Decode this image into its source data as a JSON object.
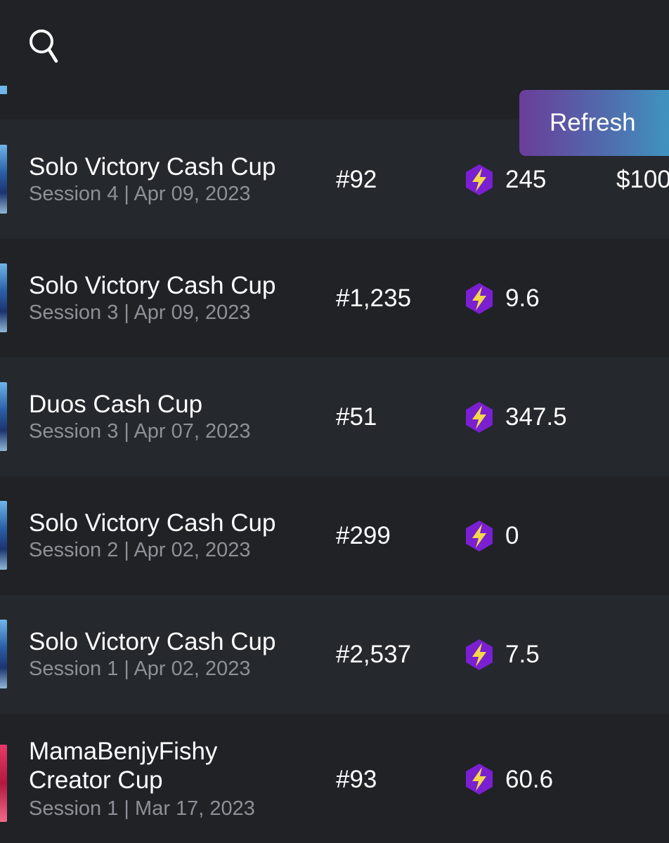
{
  "header": {
    "search_icon": "search-icon",
    "refresh_label": "Refresh"
  },
  "colors": {
    "background": "#202226",
    "row_alt": "#25282c",
    "subtext": "#8d9197",
    "points_icon_purple": "#7a1fd1",
    "points_icon_bolt": "#f4d84a",
    "refresh_gradient_start": "#6a3d9a",
    "refresh_gradient_end": "#3aa0c4"
  },
  "sessions": [
    {
      "title": "Solo Victory Cash Cup",
      "session": "Session 4",
      "date": "Apr 09, 2023",
      "rank": "#92",
      "points": "245",
      "prize": "$100"
    },
    {
      "title": "Solo Victory Cash Cup",
      "session": "Session 3",
      "date": "Apr 09, 2023",
      "rank": "#1,235",
      "points": "9.6",
      "prize": ""
    },
    {
      "title": "Duos Cash Cup",
      "session": "Session 3",
      "date": "Apr 07, 2023",
      "rank": "#51",
      "points": "347.5",
      "prize": ""
    },
    {
      "title": "Solo Victory Cash Cup",
      "session": "Session 2",
      "date": "Apr 02, 2023",
      "rank": "#299",
      "points": "0",
      "prize": ""
    },
    {
      "title": "Solo Victory Cash Cup",
      "session": "Session 1",
      "date": "Apr 02, 2023",
      "rank": "#2,537",
      "points": "7.5",
      "prize": ""
    },
    {
      "title": "MamaBenjyFishy Creator Cup",
      "session": "Session 1",
      "date": "Mar 17, 2023",
      "rank": "#93",
      "points": "60.6",
      "prize": ""
    }
  ],
  "separator": "|"
}
